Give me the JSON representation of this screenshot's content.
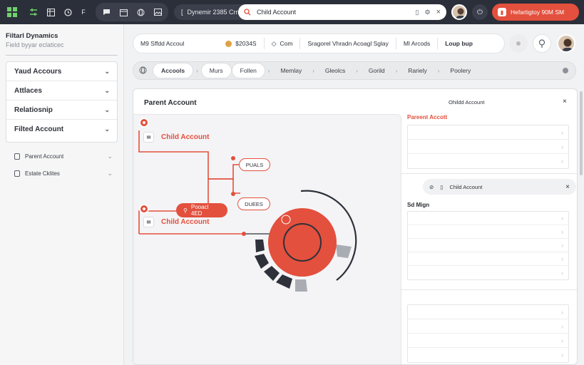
{
  "topbar": {
    "app_name": "Dynemir 2385 Crm",
    "search_value": "Child Account",
    "cta_label": "Hefartigtoy 90M SM"
  },
  "sidebar": {
    "title": "Filtarl Dynamics",
    "subtitle": "Field byyar eclaticec",
    "filters": [
      "Yaud Accours",
      "Attlaces",
      "Relatiosnip",
      "Filted Account"
    ],
    "links": [
      "Parent Account",
      "Estate Cklites"
    ]
  },
  "header": {
    "segments": [
      "M9 Sffdd Accoul",
      "$2034S",
      "Com",
      "Sragorel Vhradn Acoagl Sglay",
      "Ml Arcods",
      "Loup bup"
    ]
  },
  "tabs": [
    "Accools",
    "Murs",
    "Follen",
    "Memlay",
    "Gleolcs",
    "Gorild",
    "Rariely",
    "Poolery"
  ],
  "canvas": {
    "title": "Parent Account",
    "child_top": "Child Account",
    "child_bottom": "Child Account",
    "center_pill": "Pooacl 4ED",
    "pill_upper": "PUALS",
    "pill_lower": "DUEES"
  },
  "right_panel": {
    "title": "Ohildd Account",
    "section_label": "Pareent Accott",
    "sub_title": "Child Account",
    "section2_label": "Sd Mign"
  },
  "colors": {
    "accent": "#e3503d",
    "dark": "#2b2f3a",
    "ring_dark": "#2e313a",
    "ring_grey": "#a9acb2"
  }
}
